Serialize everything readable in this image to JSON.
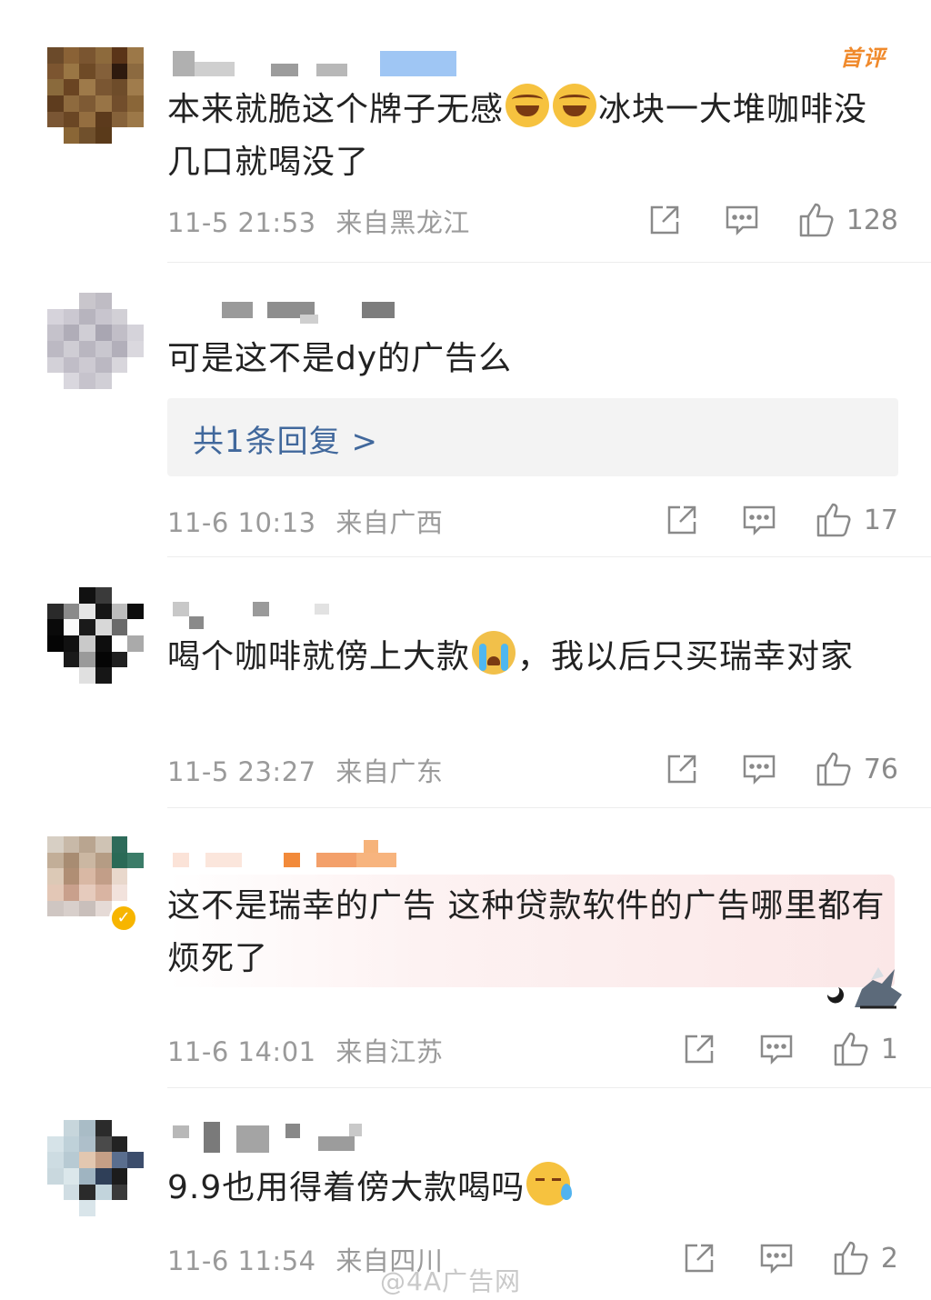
{
  "colors": {
    "accent_blue": "#41689c",
    "meta_gray": "#9a9a9a",
    "first_comment_badge": "#f08a2c",
    "verified": "#f7b500"
  },
  "comments": [
    {
      "badge": "首评",
      "text_before": "本来就脆这个牌子无感",
      "emojis": [
        "laugh",
        "laugh"
      ],
      "text_after": "冰块一大堆咖啡没几口就喝没了",
      "time": "11-5 21:53",
      "location": "来自黑龙江",
      "likes": "128"
    },
    {
      "text": "可是这不是dy的广告么",
      "replies_label": "共1条回复 >",
      "time": "11-6 10:13",
      "location": "来自广西",
      "likes": "17"
    },
    {
      "text_before": "喝个咖啡就傍上大款",
      "emojis": [
        "cry"
      ],
      "text_after": "，我以后只买瑞幸对家",
      "time": "11-5 23:27",
      "location": "来自广东",
      "likes": "76"
    },
    {
      "text": "这不是瑞幸的广告  这种贷款软件的广告哪里都有 烦死了",
      "time": "11-6 14:01",
      "location": "来自江苏",
      "likes": "1"
    },
    {
      "text_before": "9.9也用得着傍大款喝吗",
      "emojis": [
        "sweat"
      ],
      "time": "11-6 11:54",
      "location": "来自四川",
      "likes": "2"
    }
  ],
  "watermark": "@4A广告网",
  "icons": {
    "share": "share-icon",
    "reply": "comment-icon",
    "like": "thumbs-up-icon"
  }
}
